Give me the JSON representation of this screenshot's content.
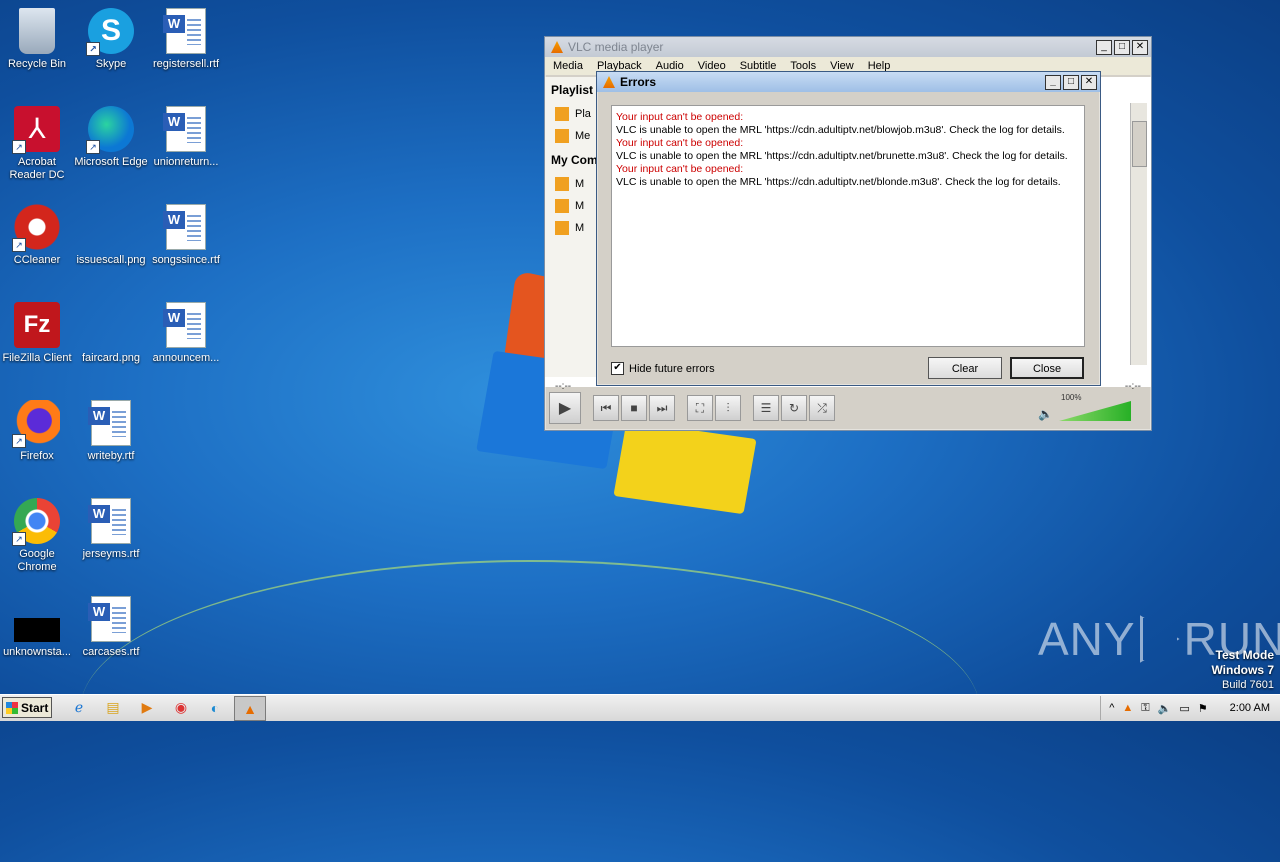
{
  "desktop": {
    "icons": [
      {
        "label": "Recycle Bin"
      },
      {
        "label": "Skype"
      },
      {
        "label": "registersell.rtf"
      },
      {
        "label": "Acrobat Reader DC"
      },
      {
        "label": "Microsoft Edge"
      },
      {
        "label": "unionreturn..."
      },
      {
        "label": "CCleaner"
      },
      {
        "label": "issuescall.png"
      },
      {
        "label": "songssince.rtf"
      },
      {
        "label": "FileZilla Client"
      },
      {
        "label": "faircard.png"
      },
      {
        "label": "announcem..."
      },
      {
        "label": "Firefox"
      },
      {
        "label": "writeby.rtf"
      },
      {
        "label": "Google Chrome"
      },
      {
        "label": "jerseyms.rtf"
      },
      {
        "label": "unknownsta..."
      },
      {
        "label": "carcases.rtf"
      }
    ]
  },
  "vlc": {
    "title": "VLC media player",
    "menu": [
      "Media",
      "Playback",
      "Audio",
      "Video",
      "Subtitle",
      "Tools",
      "View",
      "Help"
    ],
    "sidebar": {
      "playlist_header": "Playlist",
      "playlist_items": [
        "Pla",
        "Me"
      ],
      "computer_header": "My Com",
      "computer_items": [
        "M",
        "M",
        "M"
      ]
    },
    "time_left": "--:--",
    "time_right": "--:--",
    "volume": "100%"
  },
  "errors_dialog": {
    "title": "Errors",
    "messages": [
      {
        "heading": "Your input can't be opened:",
        "body": "VLC is unable to open the MRL 'https://cdn.adultiptv.net/blowjob.m3u8'. Check the log for details."
      },
      {
        "heading": "Your input can't be opened:",
        "body": "VLC is unable to open the MRL 'https://cdn.adultiptv.net/brunette.m3u8'. Check the log for details."
      },
      {
        "heading": "Your input can't be opened:",
        "body": "VLC is unable to open the MRL 'https://cdn.adultiptv.net/blonde.m3u8'. Check the log for details."
      }
    ],
    "hide_future_label": "Hide future errors",
    "hide_future_checked": true,
    "clear_label": "Clear",
    "close_label": "Close"
  },
  "watermark": {
    "brand_left": "ANY",
    "brand_right": "RUN"
  },
  "testmode": {
    "line1": "Test Mode",
    "line2": "Windows 7",
    "line3": "Build 7601"
  },
  "taskbar": {
    "start_label": "Start",
    "clock": "2:00 AM"
  }
}
